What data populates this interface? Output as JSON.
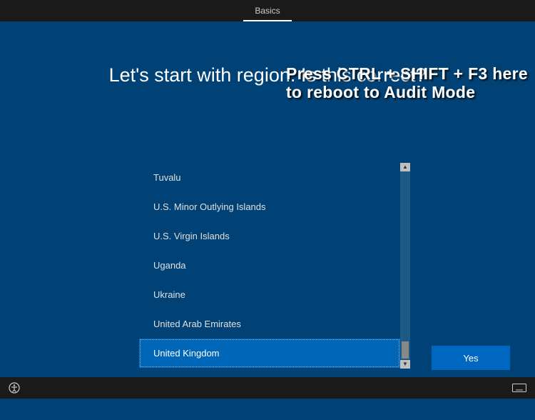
{
  "header": {
    "tab_label": "Basics"
  },
  "overlay": {
    "line1": "Press CTRL + SHIFT + F3 here",
    "line2": "to reboot to Audit Mode"
  },
  "heading": "Let's start with region. Is this correct?",
  "regions": {
    "items": [
      "Tuvalu",
      "U.S. Minor Outlying Islands",
      "U.S. Virgin Islands",
      "Uganda",
      "Ukraine",
      "United Arab Emirates",
      "United Kingdom"
    ],
    "selected_index": 6
  },
  "buttons": {
    "yes": "Yes"
  }
}
